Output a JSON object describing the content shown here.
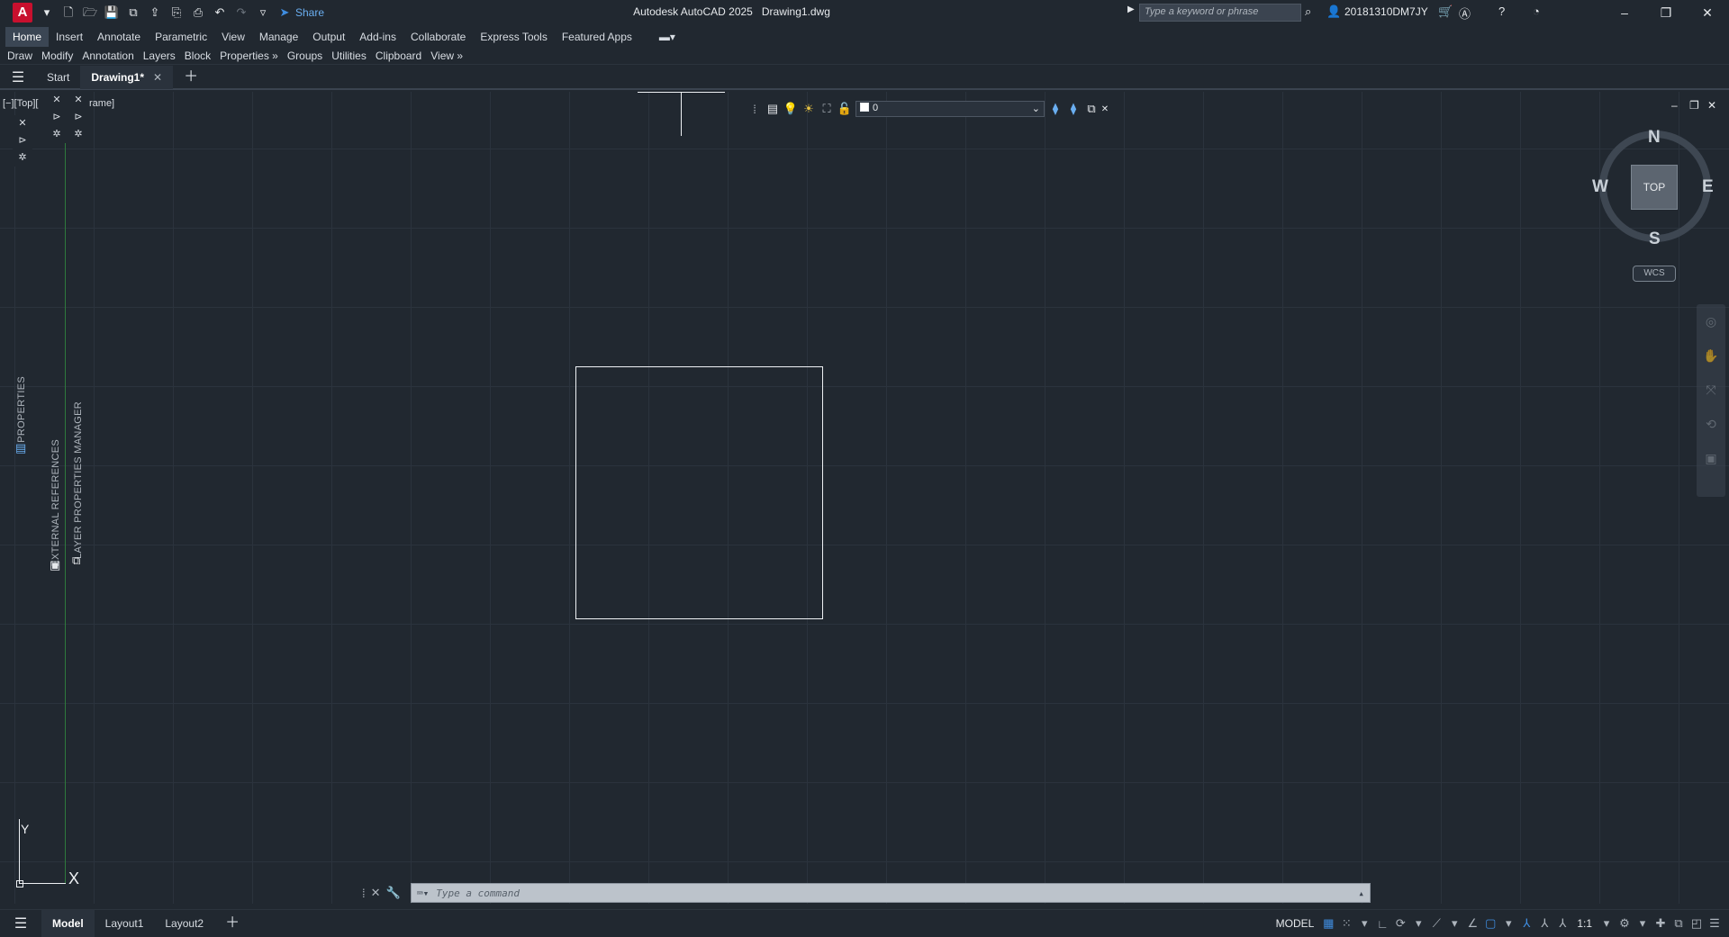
{
  "app": {
    "title": "Autodesk AutoCAD 2025",
    "filename": "Drawing1.dwg",
    "logo_letter": "A"
  },
  "quick_access": {
    "share_label": "Share"
  },
  "search": {
    "placeholder": "Type a keyword or phrase"
  },
  "user": {
    "name": "20181310DM7JY"
  },
  "ribbon_tabs": [
    {
      "label": "Home",
      "active": true
    },
    {
      "label": "Insert"
    },
    {
      "label": "Annotate"
    },
    {
      "label": "Parametric"
    },
    {
      "label": "View"
    },
    {
      "label": "Manage"
    },
    {
      "label": "Output"
    },
    {
      "label": "Add-ins"
    },
    {
      "label": "Collaborate"
    },
    {
      "label": "Express Tools"
    },
    {
      "label": "Featured Apps"
    }
  ],
  "ribbon_panels": [
    "Draw",
    "Modify",
    "Annotation",
    "Layers",
    "Block",
    "Properties »",
    "Groups",
    "Utilities",
    "Clipboard",
    "View »"
  ],
  "doc_tabs": {
    "start": "Start",
    "drawing": "Drawing1*"
  },
  "viewport": {
    "label": "[−][Top][",
    "label2": "rame]"
  },
  "palettes": {
    "properties": "PROPERTIES",
    "xref": "EXTERNAL REFERENCES",
    "layer_manager": "LAYER PROPERTIES MANAGER"
  },
  "layer_toolbar": {
    "current_layer": "0"
  },
  "viewcube": {
    "face": "TOP",
    "north": "N",
    "south": "S",
    "east": "E",
    "west": "W",
    "wcs": "WCS"
  },
  "ucs": {
    "x": "X",
    "y": "Y"
  },
  "command": {
    "placeholder": "Type a command"
  },
  "layouts": [
    "Model",
    "Layout1",
    "Layout2"
  ],
  "status": {
    "model": "MODEL",
    "scale": "1:1"
  },
  "colors": {
    "canvas": "#212830",
    "accent": "#3f8de0",
    "logo": "#c8102e"
  }
}
